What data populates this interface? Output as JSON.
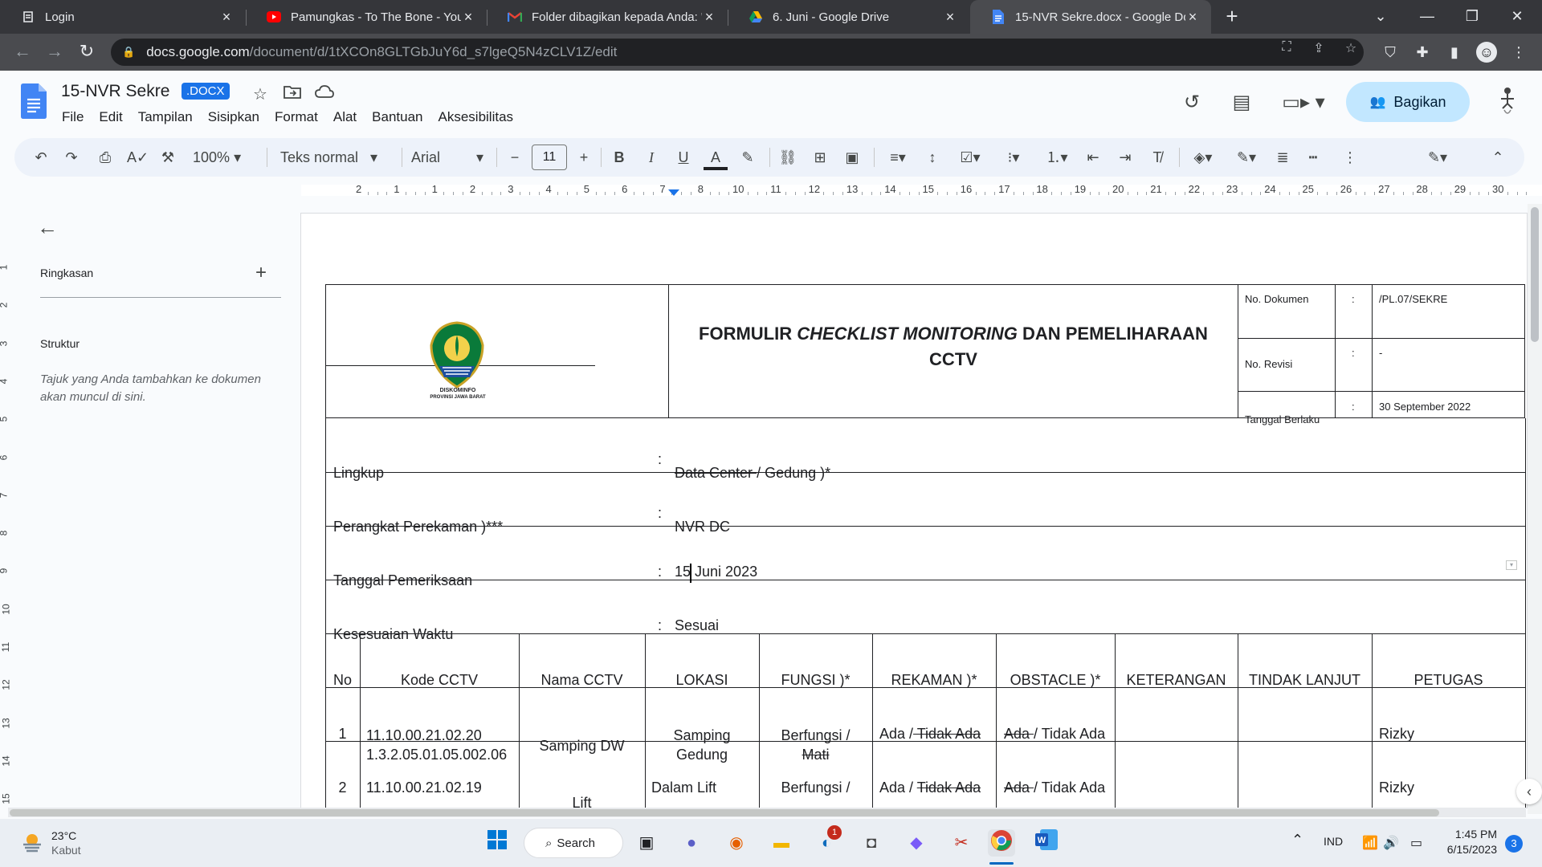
{
  "browser": {
    "tabs": [
      {
        "title": "Login",
        "favicon": "docs-lock-icon"
      },
      {
        "title": "Pamungkas - To The Bone - YouT",
        "favicon": "youtube-icon"
      },
      {
        "title": "Folder dibagikan kepada Anda: \"",
        "favicon": "gmail-icon"
      },
      {
        "title": "6. Juni - Google Drive",
        "favicon": "drive-icon"
      },
      {
        "title": "15-NVR Sekre.docx - Google Dok",
        "favicon": "docs-icon"
      }
    ],
    "url_host": "docs.google.com",
    "url_path": "/document/d/1tXCOn8GLTGbJuY6d_s7lgeQ5N4zCLV1Z/edit"
  },
  "docs": {
    "title": "15-NVR Sekre",
    "badge": ".DOCX",
    "menu": [
      "File",
      "Edit",
      "Tampilan",
      "Sisipkan",
      "Format",
      "Alat",
      "Bantuan",
      "Aksesibilitas"
    ],
    "share_label": "Bagikan",
    "toolbar": {
      "zoom": "100%",
      "style": "Teks normal",
      "font": "Arial",
      "font_size": "11"
    },
    "ruler_numbers": [
      "2",
      "1",
      "1",
      "2",
      "3",
      "4",
      "5",
      "6",
      "7",
      "8",
      "10",
      "11",
      "12",
      "13",
      "14",
      "15",
      "16",
      "17",
      "18",
      "19",
      "20",
      "21",
      "22",
      "23",
      "24",
      "25",
      "26",
      "27",
      "28",
      "29",
      "30"
    ],
    "vruler_numbers": [
      "1",
      "2",
      "3",
      "4",
      "5",
      "6",
      "7",
      "8",
      "9",
      "10",
      "11",
      "12",
      "13",
      "14",
      "15"
    ]
  },
  "outline": {
    "summary_label": "Ringkasan",
    "structure_label": "Struktur",
    "hint": "Tajuk yang Anda tambahkan ke dokumen akan muncul di sini."
  },
  "form": {
    "logo_text_1": "DISKOMINFO",
    "logo_text_2": "PROVINSI JAWA BARAT",
    "title_pre": "FORMULIR ",
    "title_italic": "CHECKLIST MONITORING",
    "title_post": " DAN PEMELIHARAAN",
    "title_line2": "CCTV",
    "meta": [
      {
        "label": "No. Dokumen",
        "colon": ":",
        "value": "/PL.07/SEKRE"
      },
      {
        "label": "No. Revisi",
        "colon": ":",
        "value": "-"
      },
      {
        "label": "Tanggal Berlaku",
        "colon": ":",
        "value": "30 September 2022"
      }
    ],
    "fields": [
      {
        "label": "Lingkup",
        "colon": ":",
        "value_strike": "Data Center ",
        "value": "/ Gedung )*"
      },
      {
        "label": "Perangkat Perekaman )***",
        "colon": ":",
        "value": "NVR DC"
      },
      {
        "label": "Tanggal Pemeriksaan",
        "colon": ":",
        "value": "15 Juni 2023"
      },
      {
        "label": "Kesesuaian Waktu",
        "colon": ":",
        "value": "Sesuai"
      }
    ],
    "columns": [
      "No",
      "Kode CCTV",
      "Nama CCTV",
      "LOKASI",
      "FUNGSI )*",
      "REKAMAN )*",
      "OBSTACLE )*",
      "KETERANGAN",
      "TINDAK LANJUT",
      "PETUGAS"
    ],
    "rows": [
      {
        "no": "1",
        "kode_1": "11.10.00.21.02.20",
        "kode_2": "1.3.2.05.01.05.002.06",
        "nama": "Samping DW",
        "lokasi_1": "Samping",
        "lokasi_2": "Gedung",
        "fungsi_1": "Berfungsi /",
        "fungsi_2_strike": "Mati",
        "rekaman_pre": "Ada /",
        "rekaman_strike": " Tidak Ada",
        "obstacle_strike": "Ada ",
        "obstacle_post": "/ Tidak Ada",
        "keterangan": "",
        "tindak": "",
        "petugas": "Rizky"
      },
      {
        "no": "2",
        "kode_1": "11.10.00.21.02.19",
        "nama": "Lift",
        "lokasi_1": "Dalam Lift",
        "fungsi_1": "Berfungsi /",
        "rekaman_pre": "Ada / ",
        "rekaman_strike": "Tidak Ada",
        "obstacle_strike": "Ada ",
        "obstacle_post": "/ Tidak Ada",
        "keterangan": "",
        "tindak": "",
        "petugas": "Rizky"
      }
    ]
  },
  "taskbar": {
    "temp": "23°C",
    "weather": "Kabut",
    "search": "Search",
    "lang": "IND",
    "time": "1:45 PM",
    "date": "6/15/2023",
    "notifications": "3",
    "teams_badge": "1"
  }
}
